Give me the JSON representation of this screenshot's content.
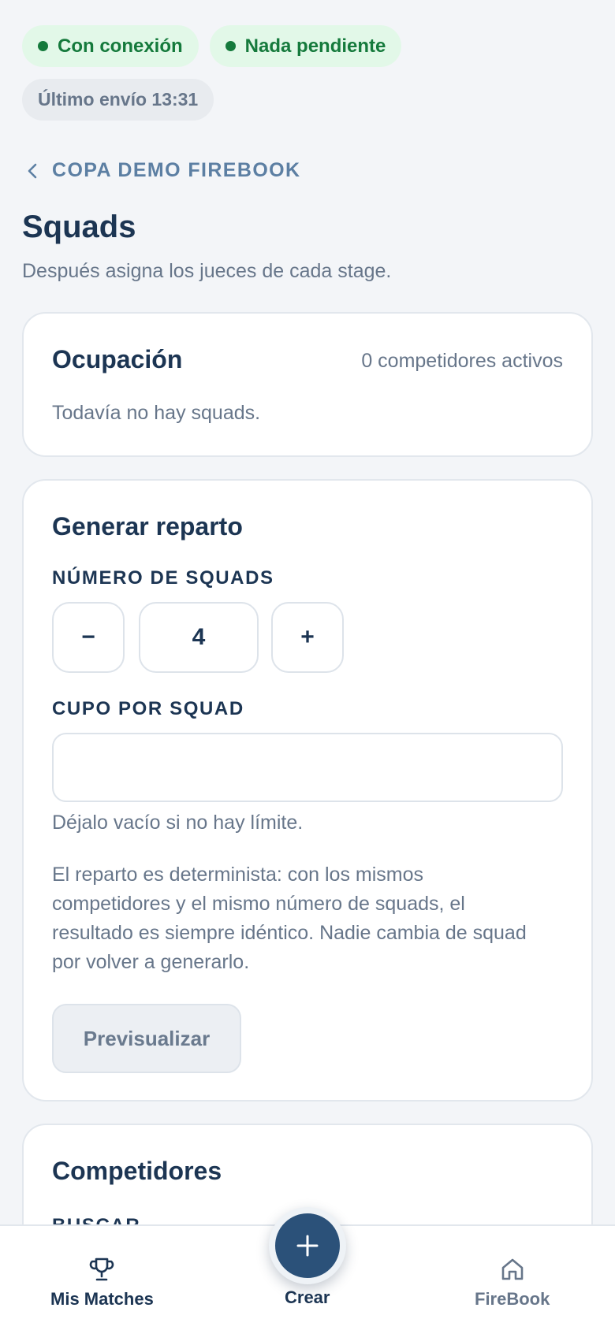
{
  "status": {
    "connection": "Con conexión",
    "pending": "Nada pendiente",
    "last_sync": "Último envío 13:31",
    "ok_color": "#157a3c"
  },
  "breadcrumb": {
    "back_label": "COPA DEMO FIREBOOK",
    "icon": "chevron-left-icon"
  },
  "page": {
    "title": "Squads",
    "subtitle": "Después asigna los jueces de cada stage."
  },
  "occupancy": {
    "title": "Ocupación",
    "count_text": "0 competidores activos",
    "empty_text": "Todavía no hay squads."
  },
  "generate": {
    "title": "Generar reparto",
    "squads_label": "NÚMERO DE SQUADS",
    "decrement_label": "−",
    "squads_value": "4",
    "increment_label": "+",
    "quota_label": "CUPO POR SQUAD",
    "quota_value": "",
    "quota_hint": "Déjalo vacío si no hay límite.",
    "explanation": "El reparto es determinista: con los mismos competidores y el mismo número de squads, el resultado es siempre idéntico. Nadie cambia de squad por volver a generarlo.",
    "preview_button": "Previsualizar"
  },
  "competitors": {
    "title": "Competidores",
    "search_label": "BUSCAR"
  },
  "nav": {
    "items": [
      {
        "label": "Mis Matches",
        "icon": "trophy-icon"
      },
      {
        "label": "Crear",
        "icon": "plus-icon"
      },
      {
        "label": "FireBook",
        "icon": "home-icon"
      }
    ],
    "active_color": "#1c3553",
    "inactive_color": "#67768a",
    "fab_color": "#2b5179"
  }
}
